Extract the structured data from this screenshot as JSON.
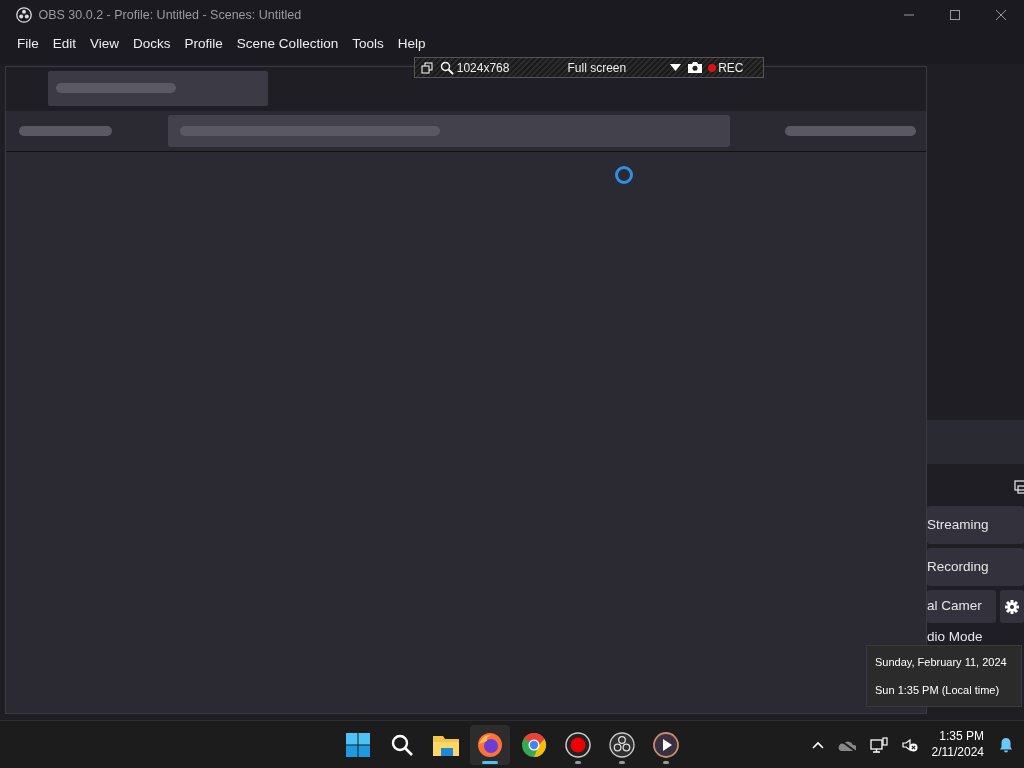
{
  "window": {
    "title": "OBS 30.0.2 - Profile: Untitled - Scenes: Untitled"
  },
  "menu": [
    {
      "label": "File"
    },
    {
      "label": "Edit"
    },
    {
      "label": "View"
    },
    {
      "label": "Docks"
    },
    {
      "label": "Profile"
    },
    {
      "label": "Scene Collection"
    },
    {
      "label": "Tools"
    },
    {
      "label": "Help"
    }
  ],
  "capture_toolbar": {
    "resolution": "1024x768",
    "mode": "Full screen",
    "record_label": "REC"
  },
  "controls": [
    {
      "kind": "button",
      "label": "Streaming"
    },
    {
      "kind": "button",
      "label": "Recording"
    },
    {
      "kind": "split",
      "label": "al Camer"
    },
    {
      "kind": "plain",
      "label": "dio Mode"
    }
  ],
  "clock_tooltip": {
    "date": "Sunday, February 11, 2024",
    "local_time": "Sun 1:35 PM (Local time)"
  },
  "taskbar": {
    "apps": [
      {
        "kind": "start",
        "running": false,
        "selected": false
      },
      {
        "kind": "search",
        "running": false,
        "selected": false
      },
      {
        "kind": "folder",
        "running": false,
        "selected": false
      },
      {
        "kind": "fox",
        "running": true,
        "selected": true
      },
      {
        "kind": "chrome",
        "running": false,
        "selected": false
      },
      {
        "kind": "recorder",
        "running": true,
        "selected": false
      },
      {
        "kind": "obs",
        "running": true,
        "selected": false
      },
      {
        "kind": "player",
        "running": true,
        "selected": false
      }
    ],
    "clock": {
      "time": "1:35 PM",
      "date": "2/11/2024"
    }
  }
}
